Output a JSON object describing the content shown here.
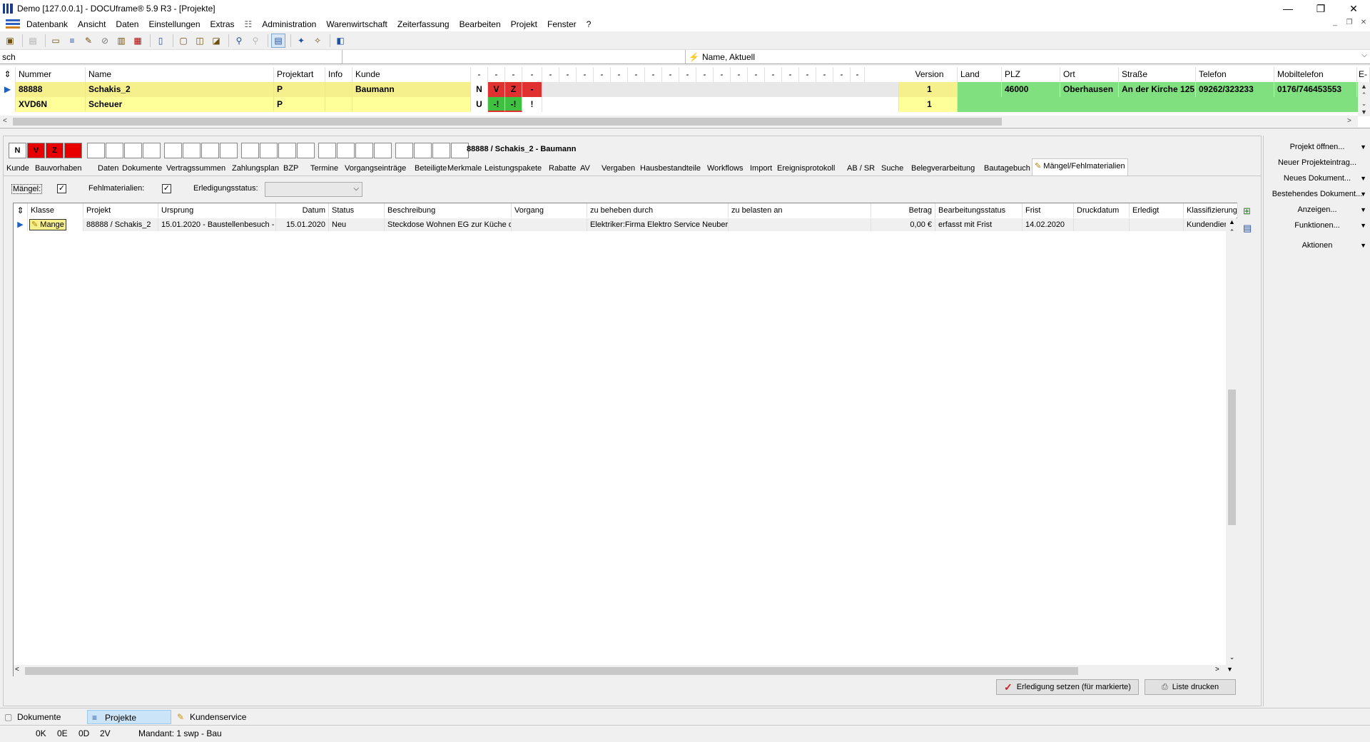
{
  "window": {
    "title": "Demo [127.0.0.1] - DOCUframe® 5.9 R3 - [Projekte]",
    "minimize": "—",
    "maximize": "❐",
    "close": "✕"
  },
  "menu": [
    "Datenbank",
    "Ansicht",
    "Daten",
    "Einstellungen",
    "Extras",
    "Administration",
    "Warenwirtschaft",
    "Zeiterfassung",
    "Bearbeiten",
    "Projekt",
    "Fenster",
    "?"
  ],
  "search": {
    "value": "sch",
    "filter_label": "Name, Aktuell"
  },
  "project_grid": {
    "headers": {
      "nummer": "Nummer",
      "name": "Name",
      "projektart": "Projektart",
      "info": "Info",
      "kunde": "Kunde",
      "dash": "-",
      "version": "Version",
      "land": "Land",
      "plz": "PLZ",
      "ort": "Ort",
      "strasse": "Straße",
      "telefon": "Telefon",
      "mobil": "Mobiltelefon",
      "email": "E-"
    },
    "rows": [
      {
        "nummer": "88888",
        "name": "Schakis_2",
        "projektart": "P",
        "info": "",
        "kunde": "Baumann",
        "s1": "N",
        "s2": "V",
        "s3": "Z",
        "s4": "-",
        "version": "1",
        "land": "",
        "plz": "46000",
        "ort": "Oberhausen",
        "strasse": "An der Kirche 125",
        "telefon": "09262/323233",
        "mobil": "0176/746453553"
      },
      {
        "nummer": "XVD6N",
        "name": "Scheuer",
        "projektart": "P",
        "info": "",
        "kunde": "",
        "s1": "U",
        "s2": "-!",
        "s3": "-!",
        "s4": "!",
        "version": "1",
        "land": "",
        "plz": "",
        "ort": "",
        "strasse": "",
        "telefon": "",
        "mobil": ""
      }
    ]
  },
  "detail": {
    "status_boxes": [
      "N",
      "V",
      "Z",
      ""
    ],
    "header": "88888 / Schakis_2 - Baumann",
    "tabs": [
      "Kunde",
      "Bauvorhaben",
      "Daten",
      "Dokumente",
      "Vertragssummen",
      "Zahlungsplan",
      "BZP",
      "Termine",
      "Vorgangseinträge",
      "Beteiligte",
      "Merkmale",
      "Leistungspakete",
      "Rabatte",
      "AV",
      "Vergaben",
      "Hausbestandteile",
      "Workflows",
      "Import",
      "Ereignisprotokoll",
      "AB / SR",
      "Suche",
      "Belegverarbeitung",
      "Bautagebuch",
      "Mängel/Fehlmaterialien"
    ],
    "filters": {
      "maengel_label": "Mängel:",
      "fehlmaterialien_label": "Fehlmaterialien:",
      "erledigungsstatus_label": "Erledigungsstatus:",
      "erledigungsstatus_value": ""
    },
    "grid_headers": [
      "Klasse",
      "Projekt",
      "Ursprung",
      "Datum",
      "Status",
      "Beschreibung",
      "Vorgang",
      "zu beheben durch",
      "zu belasten an",
      "Betrag",
      "Bearbeitungsstatus",
      "Frist",
      "Druckdatum",
      "Erledigt",
      "Klassifizierung"
    ],
    "grid_row": {
      "klasse": "Mange",
      "projekt": "88888 / Schakis_2",
      "ursprung": "15.01.2020 - Baustellenbesuch -",
      "datum": "15.01.2020",
      "status": "Neu",
      "beschreibung": "Steckdose Wohnen EG zur Küche d",
      "vorgang": "",
      "zu_beheben": "Elektriker:Firma Elektro Service Neuber/E",
      "zu_belasten": "",
      "betrag": "0,00 €",
      "bearbeitungsstatus": "erfasst mit Frist",
      "frist": "14.02.2020",
      "druckdatum": "",
      "erledigt": "",
      "klassifizierung": "Kundendienst"
    },
    "buttons": {
      "erledigung": "Erledigung setzen (für markierte)",
      "drucken": "Liste drucken"
    }
  },
  "side_panel": [
    "Projekt öffnen...",
    "Neuer Projekteintrag...",
    "Neues Dokument...",
    "Bestehendes Dokument...",
    "Anzeigen...",
    "Funktionen...",
    "Aktionen"
  ],
  "bottom_nav": [
    "Dokumente",
    "Projekte",
    "Kundenservice"
  ],
  "status_bar": {
    "k": "0K",
    "e": "0E",
    "d": "0D",
    "v": "2V",
    "mandant": "Mandant: 1 swp - Bau"
  },
  "colors": {
    "row_yellow": "#f6f08c",
    "row_yellow2": "#ffff99",
    "red": "#e03030",
    "green": "#80e080",
    "selected_tab": "#ffffff"
  }
}
